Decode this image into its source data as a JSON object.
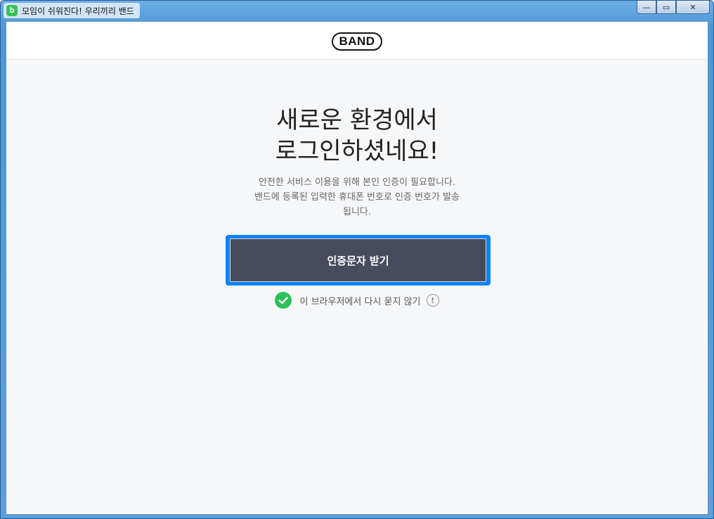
{
  "window": {
    "title": "모임이 쉬워진다! 우리끼리 밴드",
    "app_icon_glyph": "b",
    "controls": {
      "minimize": "—",
      "maximize": "▭",
      "close": "✕"
    }
  },
  "header": {
    "logo": "BAND"
  },
  "main": {
    "headline_line1": "새로운 환경에서",
    "headline_line2": "로그인하셨네요!",
    "desc_line1": "안전한 서비스 이용을 위해 본인 인증이 필요합니다.",
    "desc_line2": "밴드에 등록된 입력한 휴대폰 번호로 인증 번호가 발송",
    "desc_line3": "됩니다.",
    "cta_label": "인증문자 받기",
    "remember_label": "이 브라우저에서 다시 묻지 않기",
    "info_glyph": "!"
  },
  "colors": {
    "cta_background": "#464c5e",
    "focus_ring": "#0a84ff",
    "check": "#2dc15c"
  },
  "icons": {
    "app": "band-app-icon",
    "check": "check-circle-icon",
    "info": "info-circle-icon"
  }
}
